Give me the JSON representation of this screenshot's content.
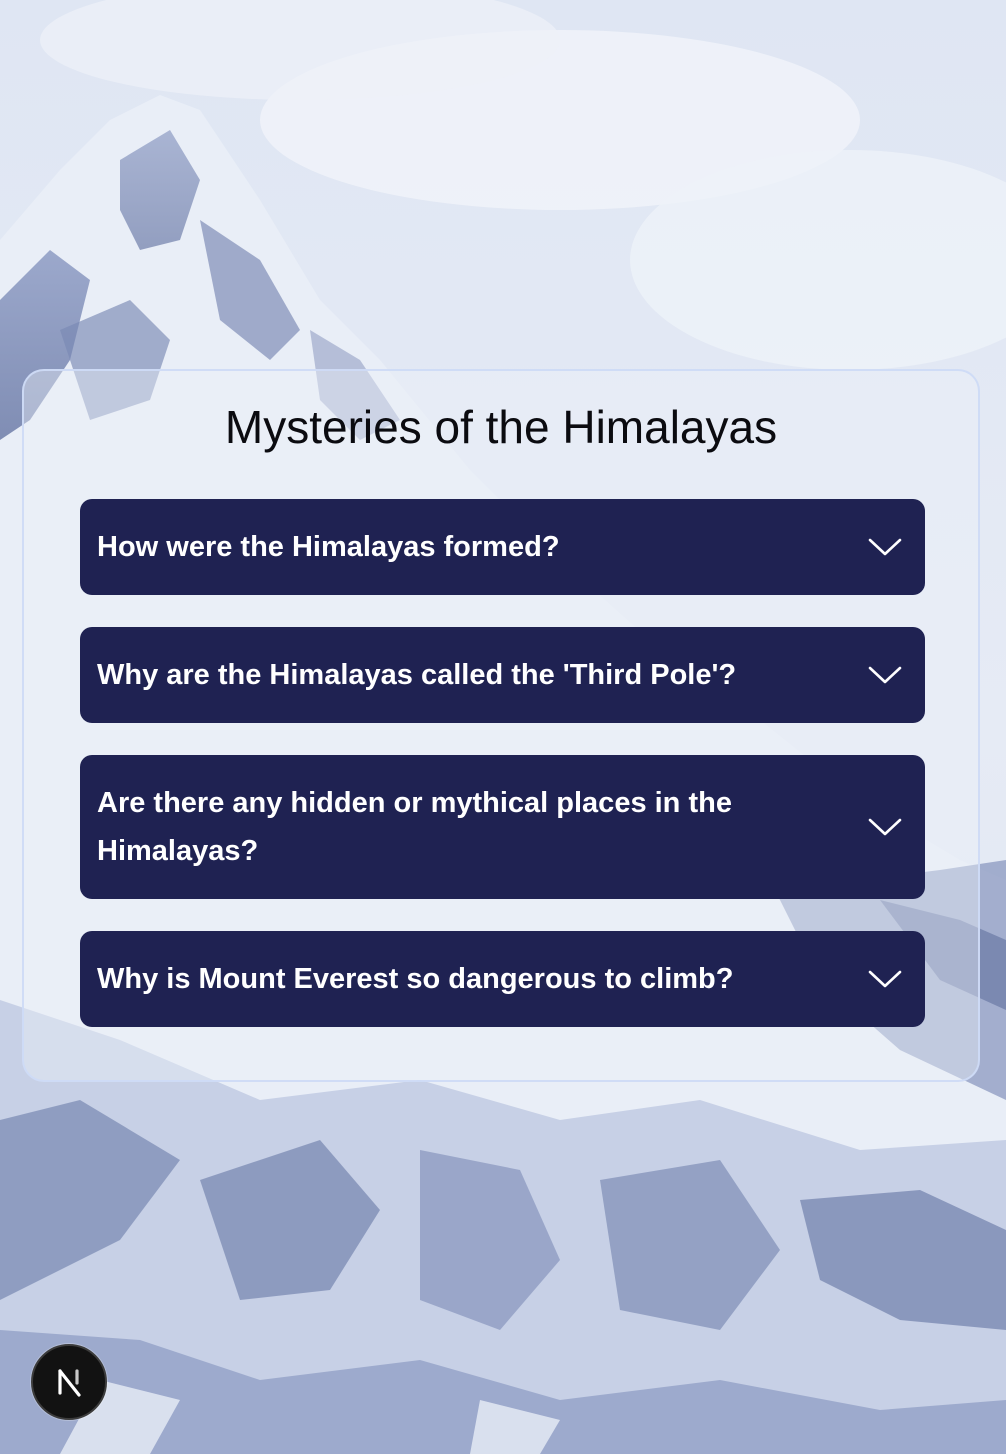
{
  "page": {
    "title": "Mysteries of the Himalayas"
  },
  "faq": {
    "items": [
      {
        "question": "How were the Himalayas formed?",
        "expanded": false
      },
      {
        "question": "Why are the Himalayas called the 'Third Pole'?",
        "expanded": false
      },
      {
        "question": "Are there any hidden or mythical places in the Himalayas?",
        "expanded": false
      },
      {
        "question": "Why is Mount Everest so dangerous to climb?",
        "expanded": false
      }
    ],
    "toggle_icon": "chevron-down-icon"
  },
  "badge": {
    "icon": "nextjs-logo-icon"
  },
  "colors": {
    "item_background": "#1f2252",
    "item_text": "#ffffff",
    "panel_border": "#cddaf5",
    "title_text": "#0b0b10"
  }
}
